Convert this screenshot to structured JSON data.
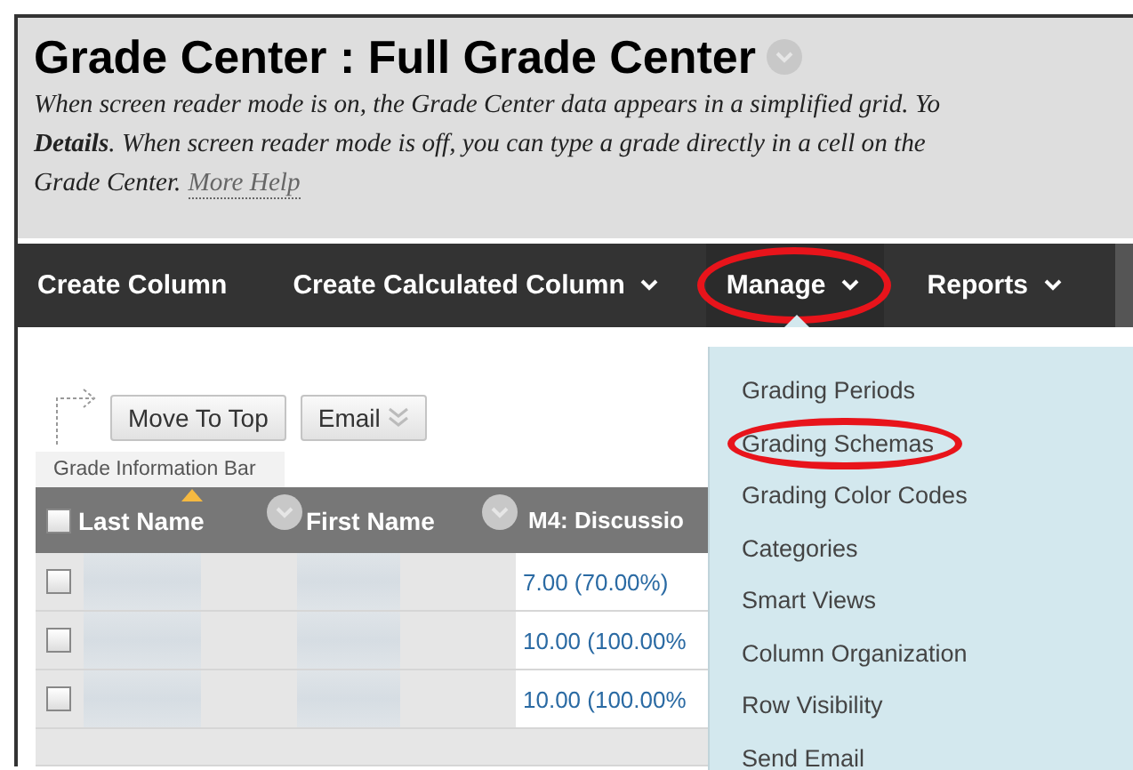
{
  "header": {
    "title": "Grade Center : Full Grade Center",
    "description": [
      "When screen reader mode is on, the Grade Center data appears in a simplified grid. Yo",
      "**Details**. When screen reader mode is off, you can type a grade directly in a cell on the",
      "Grade Center."
    ],
    "help_link": "More Help"
  },
  "nav": [
    {
      "label": "Create Column",
      "has_menu": false,
      "highlighted": false,
      "expanded": false
    },
    {
      "label": "Create Calculated Column",
      "has_menu": true,
      "highlighted": false,
      "expanded": false
    },
    {
      "label": "Manage",
      "has_menu": true,
      "highlighted": true,
      "expanded": true
    },
    {
      "label": "Reports",
      "has_menu": true,
      "highlighted": false,
      "expanded": false
    }
  ],
  "menu": [
    {
      "label": "Grading Periods",
      "highlighted": false
    },
    {
      "label": "Grading Schemas",
      "highlighted": true
    },
    {
      "label": "Grading Color Codes",
      "highlighted": false
    },
    {
      "label": "Categories",
      "highlighted": false
    },
    {
      "label": "Smart Views",
      "highlighted": false
    },
    {
      "label": "Column Organization",
      "highlighted": false
    },
    {
      "label": "Row Visibility",
      "highlighted": false
    },
    {
      "label": "Send Email",
      "highlighted": false
    }
  ],
  "toolbar": {
    "buttons": [
      {
        "label": "Move To Top",
        "has_menu": false
      },
      {
        "label": "Email",
        "has_menu": true
      }
    ]
  },
  "info_bar": "Grade Information Bar",
  "table": {
    "select_all_checked": false,
    "columns": [
      {
        "label": "Last Name",
        "sorted": true,
        "has_menu": true
      },
      {
        "label": "First Name",
        "sorted": false,
        "has_menu": true
      },
      {
        "label": "M4: Discussio",
        "sorted": false,
        "has_menu": false
      }
    ],
    "rows": [
      {
        "checked": false,
        "grade": "7.00 (70.00%)"
      },
      {
        "checked": false,
        "grade": "10.00 (100.00%"
      },
      {
        "checked": false,
        "grade": "10.00 (100.00%"
      }
    ]
  }
}
